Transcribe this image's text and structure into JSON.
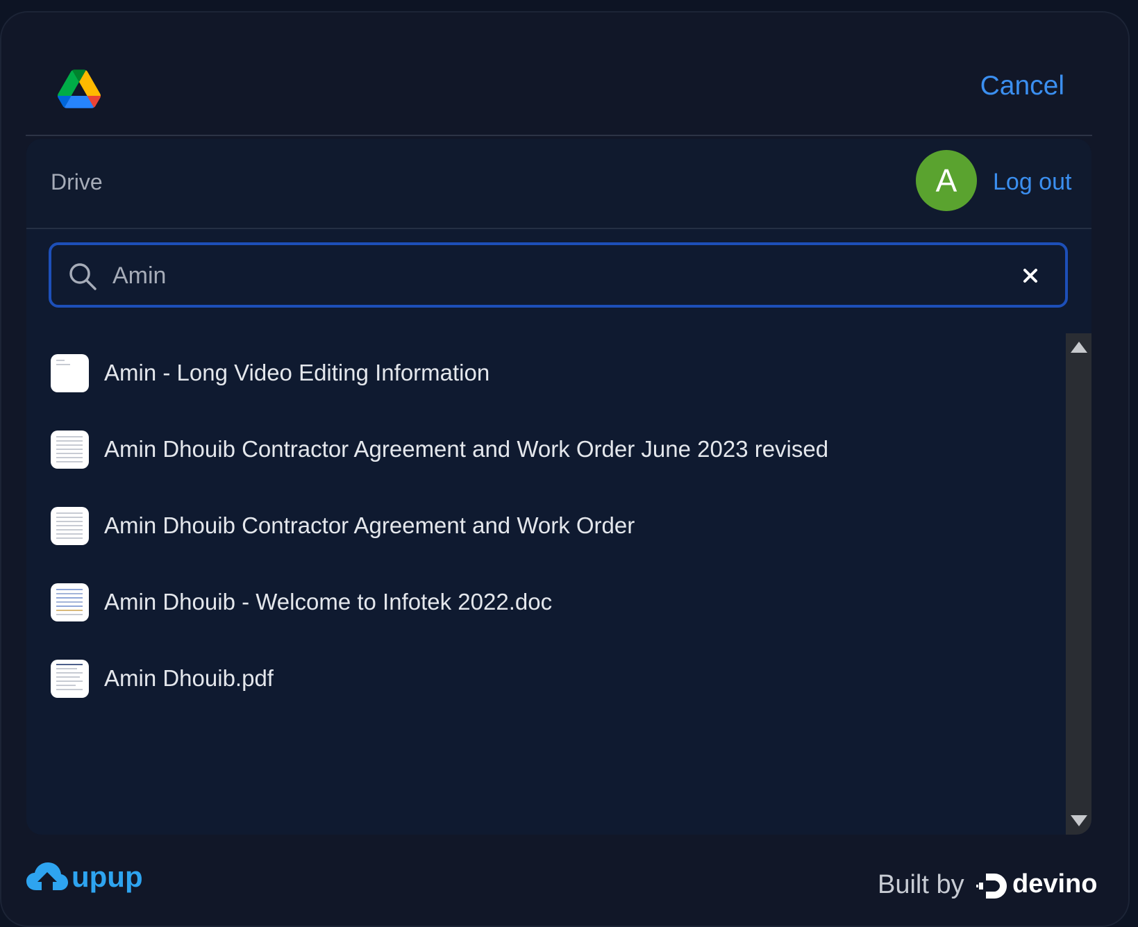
{
  "header": {
    "logo_icon": "google-drive-icon",
    "cancel_label": "Cancel"
  },
  "browser": {
    "breadcrumb": "Drive",
    "avatar_initial": "A",
    "avatar_color": "#5aa32f",
    "logout_label": "Log out"
  },
  "search": {
    "value": "Amin",
    "icon": "search-icon",
    "clear_icon": "close-icon"
  },
  "files": [
    {
      "name": "Amin - Long Video Editing Information"
    },
    {
      "name": "Amin Dhouib Contractor Agreement and Work Order June 2023 revised"
    },
    {
      "name": "Amin Dhouib Contractor Agreement and Work Order"
    },
    {
      "name": "Amin Dhouib - Welcome to Infotek 2022.doc"
    },
    {
      "name": "Amin Dhouib.pdf"
    }
  ],
  "footer": {
    "brand": "upup",
    "built_by": "Built by",
    "builder": "devino"
  },
  "colors": {
    "accent": "#3b8ff0",
    "search_border": "#1d4fb8",
    "background": "#111728"
  }
}
